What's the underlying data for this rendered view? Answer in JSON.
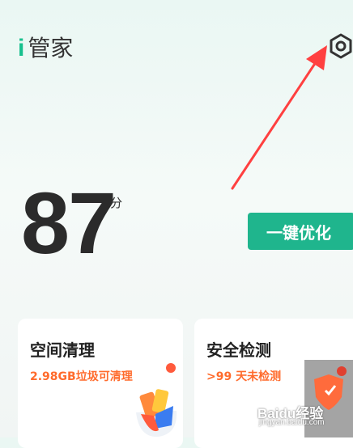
{
  "header": {
    "logo_letter": "i",
    "title": "管家"
  },
  "score": {
    "value": "87",
    "unit": "分"
  },
  "optimize_button": {
    "label": "一键优化"
  },
  "cards": [
    {
      "title": "空间清理",
      "subtitle": "2.98GB垃圾可清理"
    },
    {
      "title": "安全检测",
      "subtitle": ">99 天未检测"
    }
  ],
  "watermark": {
    "text": "Baidu经验",
    "url": "jingyan.baidu.com"
  },
  "colors": {
    "accent": "#1fb58d",
    "warning": "#ff6b2c",
    "annotation_arrow": "#ff4040"
  },
  "icons": {
    "settings": "gear-icon"
  }
}
